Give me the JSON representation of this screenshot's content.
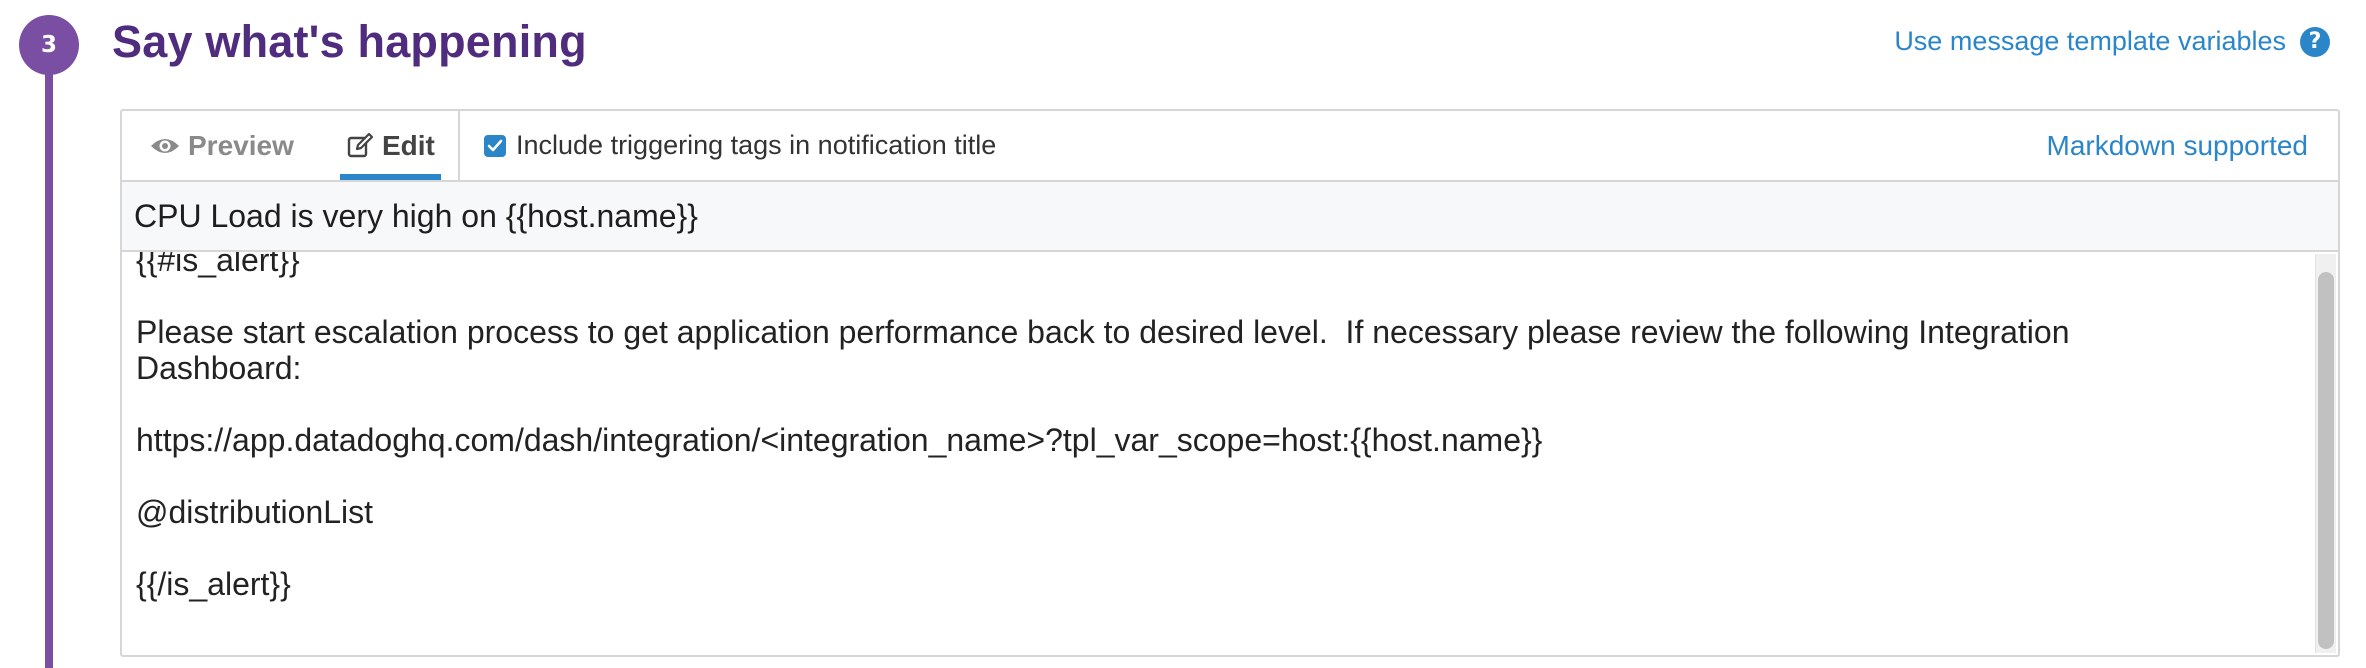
{
  "step": {
    "number": "3",
    "title": "Say what's happening"
  },
  "links": {
    "template_variables": "Use message template variables",
    "help_icon": "?",
    "markdown": "Markdown supported"
  },
  "tabs": {
    "preview": "Preview",
    "edit": "Edit",
    "active": "Edit"
  },
  "options": {
    "include_tags_label": "Include triggering tags in notification title",
    "include_tags_checked": true
  },
  "message": {
    "title": "CPU Load is very high on {{host.name}}",
    "body_lines": [
      "{{#is_alert}}",
      "",
      "Please start escalation process to get application performance back to desired level.  If necessary please review the following Integration",
      "Dashboard:",
      "",
      "https://app.datadoghq.com/dash/integration/<integration_name>?tpl_var_scope=host:{{host.name}}",
      "",
      "@distributionList",
      "",
      "{{/is_alert}}"
    ]
  },
  "colors": {
    "step_accent": "#7a4fa3",
    "title": "#4f2c7e",
    "link": "#2a86c8"
  },
  "icons": {
    "preview_tab": "eye-icon",
    "edit_tab": "edit-icon",
    "help": "question-circle-icon",
    "checkbox": "checkmark-icon"
  }
}
